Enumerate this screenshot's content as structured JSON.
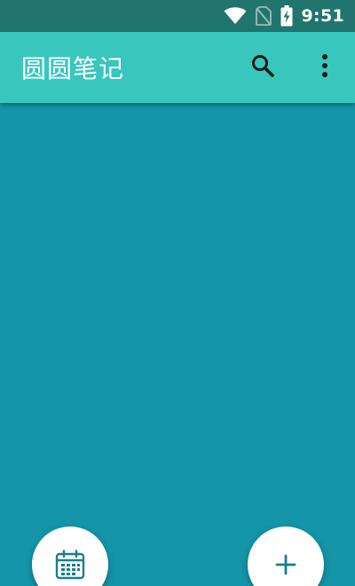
{
  "status_bar": {
    "time": "9:51",
    "icons": [
      "wifi-icon",
      "no-sim-icon",
      "battery-charging-icon"
    ]
  },
  "app_bar": {
    "title": "圆圆笔记",
    "actions": [
      "search-icon",
      "more-vert-icon"
    ]
  },
  "fabs": {
    "left": "calendar-icon",
    "right": "add-icon"
  },
  "colors": {
    "status_bar": "#22756f",
    "app_bar": "#38c6bd",
    "background": "#1496a8",
    "fab": "#ffffff",
    "fab_icon": "#1a7f8c"
  }
}
